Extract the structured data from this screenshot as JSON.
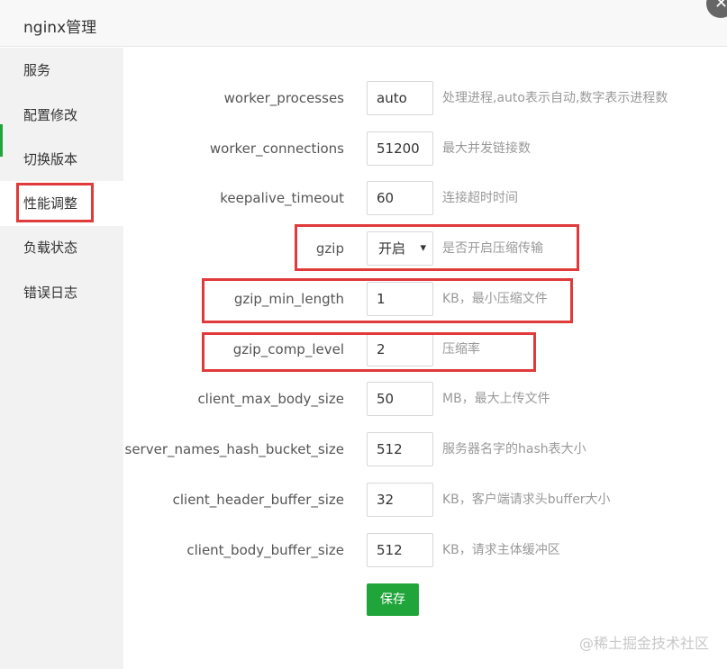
{
  "dialog": {
    "title": "nginx管理",
    "close_glyph": "✕"
  },
  "sidebar": {
    "items": [
      {
        "label": "服务"
      },
      {
        "label": "配置修改"
      },
      {
        "label": "切换版本"
      },
      {
        "label": "性能调整"
      },
      {
        "label": "负载状态"
      },
      {
        "label": "错误日志"
      }
    ],
    "active_index": 3
  },
  "settings": [
    {
      "name": "worker_processes",
      "value": "auto",
      "help": "处理进程,auto表示自动,数字表示进程数"
    },
    {
      "name": "worker_connections",
      "value": "51200",
      "help": "最大并发链接数"
    },
    {
      "name": "keepalive_timeout",
      "value": "60",
      "help": "连接超时时间"
    },
    {
      "name": "gzip",
      "value": "开启",
      "help": "是否开启压缩传输"
    },
    {
      "name": "gzip_min_length",
      "value": "1",
      "help": "KB，最小压缩文件"
    },
    {
      "name": "gzip_comp_level",
      "value": "2",
      "help": "压缩率"
    },
    {
      "name": "client_max_body_size",
      "value": "50",
      "help": "MB，最大上传文件"
    },
    {
      "name": "server_names_hash_bucket_size",
      "value": "512",
      "help": "服务器名字的hash表大小"
    },
    {
      "name": "client_header_buffer_size",
      "value": "32",
      "help": "KB，客户端请求头buffer大小"
    },
    {
      "name": "client_body_buffer_size",
      "value": "512",
      "help": "KB，请求主体缓冲区"
    }
  ],
  "save_label": "保存",
  "watermark": "@稀土掘金技术社区",
  "colors": {
    "accent": "#20a53a",
    "highlight": "#e03a3a"
  }
}
